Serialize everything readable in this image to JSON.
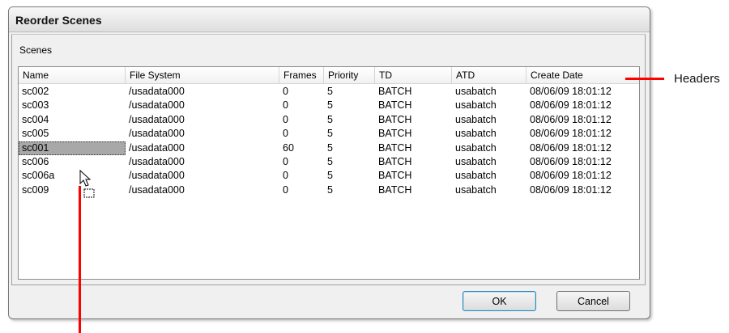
{
  "dialog": {
    "title": "Reorder Scenes",
    "group_label": "Scenes"
  },
  "table": {
    "headers": [
      "Name",
      "File System",
      "Frames",
      "Priority",
      "TD",
      "ATD",
      "Create Date"
    ],
    "rows": [
      [
        "sc002",
        "/usadata000",
        "0",
        "5",
        "BATCH",
        "usabatch",
        "08/06/09 18:01:12"
      ],
      [
        "sc003",
        "/usadata000",
        "0",
        "5",
        "BATCH",
        "usabatch",
        "08/06/09 18:01:12"
      ],
      [
        "sc004",
        "/usadata000",
        "0",
        "5",
        "BATCH",
        "usabatch",
        "08/06/09 18:01:12"
      ],
      [
        "sc005",
        "/usadata000",
        "0",
        "5",
        "BATCH",
        "usabatch",
        "08/06/09 18:01:12"
      ],
      [
        "sc001",
        "/usadata000",
        "60",
        "5",
        "BATCH",
        "usabatch",
        "08/06/09 18:01:12"
      ],
      [
        "sc006",
        "/usadata000",
        "0",
        "5",
        "BATCH",
        "usabatch",
        "08/06/09 18:01:12"
      ],
      [
        "sc006a",
        "/usadata000",
        "0",
        "5",
        "BATCH",
        "usabatch",
        "08/06/09 18:01:12"
      ],
      [
        "sc009",
        "/usadata000",
        "0",
        "5",
        "BATCH",
        "usabatch",
        "08/06/09 18:01:12"
      ]
    ],
    "selected_row": "sc001"
  },
  "buttons": {
    "ok": "OK",
    "cancel": "Cancel"
  },
  "annotation": {
    "headers_label": "Headers",
    "color": "#ff0000"
  },
  "icons": {
    "cursor": "drag-cursor-icon"
  }
}
